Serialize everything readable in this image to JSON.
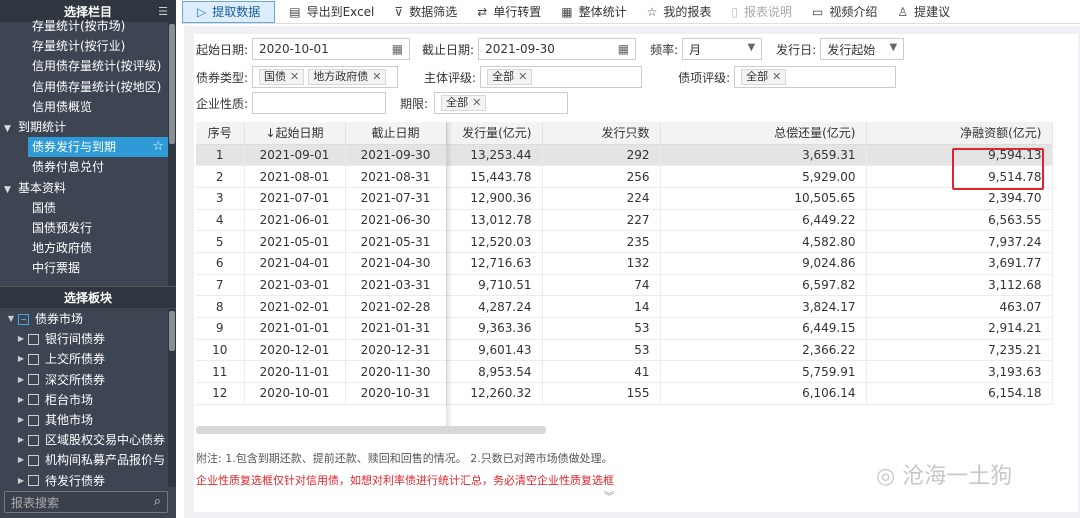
{
  "sidebar": {
    "title": "选择栏目",
    "items": [
      {
        "label": "存量统计(按市场)",
        "type": "sub"
      },
      {
        "label": "存量统计(按行业)",
        "type": "sub"
      },
      {
        "label": "信用债存量统计(按评级)",
        "type": "sub"
      },
      {
        "label": "信用债存量统计(按地区)",
        "type": "sub"
      },
      {
        "label": "信用债概览",
        "type": "sub"
      },
      {
        "label": "到期统计",
        "type": "cat"
      },
      {
        "label": "债券发行与到期",
        "type": "active"
      },
      {
        "label": "债券付息兑付",
        "type": "sub"
      },
      {
        "label": "基本资料",
        "type": "cat"
      },
      {
        "label": "国债",
        "type": "sub"
      },
      {
        "label": "国债预发行",
        "type": "sub"
      },
      {
        "label": "地方政府债",
        "type": "sub"
      },
      {
        "label": "中行票据",
        "type": "sub"
      }
    ],
    "section2_title": "选择板块",
    "tree": [
      {
        "label": "债券市场",
        "level": 0,
        "state": "partial",
        "arrow": "▼"
      },
      {
        "label": "银行间债券",
        "level": 1,
        "state": "empty",
        "arrow": "▶"
      },
      {
        "label": "上交所债券",
        "level": 1,
        "state": "empty",
        "arrow": "▶"
      },
      {
        "label": "深交所债券",
        "level": 1,
        "state": "empty",
        "arrow": "▶"
      },
      {
        "label": "柜台市场",
        "level": 1,
        "state": "empty",
        "arrow": "▶"
      },
      {
        "label": "其他市场",
        "level": 1,
        "state": "empty",
        "arrow": "▶"
      },
      {
        "label": "区域股权交易中心债券",
        "level": 1,
        "state": "empty",
        "arrow": "▶"
      },
      {
        "label": "机构间私募产品报价与",
        "level": 1,
        "state": "empty",
        "arrow": "▶"
      },
      {
        "label": "待发行债券",
        "level": 1,
        "state": "empty",
        "arrow": "▶"
      }
    ],
    "search_placeholder": "报表搜索"
  },
  "toolbar": {
    "items": [
      {
        "label": "提取数据",
        "icon": "play-icon",
        "glyph": "▷",
        "style": "primary"
      },
      {
        "label": "导出到Excel",
        "icon": "excel-icon",
        "glyph": "▤",
        "style": ""
      },
      {
        "label": "数据筛选",
        "icon": "filter-icon",
        "glyph": "⊽",
        "style": ""
      },
      {
        "label": "单行转置",
        "icon": "transpose-icon",
        "glyph": "⇄",
        "style": ""
      },
      {
        "label": "整体统计",
        "icon": "stats-icon",
        "glyph": "▦",
        "style": ""
      },
      {
        "label": "我的报表",
        "icon": "star-icon",
        "glyph": "☆",
        "style": ""
      },
      {
        "label": "报表说明",
        "icon": "doc-icon",
        "glyph": "▯",
        "style": "disabled"
      },
      {
        "label": "视频介绍",
        "icon": "video-icon",
        "glyph": "▭",
        "style": ""
      },
      {
        "label": "提建议",
        "icon": "user-icon",
        "glyph": "♙",
        "style": ""
      }
    ]
  },
  "filters": {
    "start_label": "起始日期:",
    "start_value": "2020-10-01",
    "end_label": "截止日期:",
    "end_value": "2021-09-30",
    "freq_label": "频率:",
    "freq_value": "月",
    "issue_label": "发行日:",
    "issue_value": "发行起始",
    "bondtype_label": "债券类型:",
    "bondtype_tags": [
      "国债",
      "地方政府债"
    ],
    "rating_label": "主体评级:",
    "rating_tags": [
      "全部"
    ],
    "itemrating_label": "债项评级:",
    "itemrating_tags": [
      "全部"
    ],
    "nature_label": "企业性质:",
    "term_label": "期限:",
    "term_tags": [
      "全部"
    ]
  },
  "table": {
    "headers": [
      "序号",
      "↓起始日期",
      "截止日期",
      "发行量(亿元)",
      "发行只数",
      "总偿还量(亿元)",
      "净融资额(亿元)"
    ],
    "rows": [
      [
        "1",
        "2021-09-01",
        "2021-09-30",
        "13,253.44",
        "292",
        "3,659.31",
        "9,594.13"
      ],
      [
        "2",
        "2021-08-01",
        "2021-08-31",
        "15,443.78",
        "256",
        "5,929.00",
        "9,514.78"
      ],
      [
        "3",
        "2021-07-01",
        "2021-07-31",
        "12,900.36",
        "224",
        "10,505.65",
        "2,394.70"
      ],
      [
        "4",
        "2021-06-01",
        "2021-06-30",
        "13,012.78",
        "227",
        "6,449.22",
        "6,563.55"
      ],
      [
        "5",
        "2021-05-01",
        "2021-05-31",
        "12,520.03",
        "235",
        "4,582.80",
        "7,937.24"
      ],
      [
        "6",
        "2021-04-01",
        "2021-04-30",
        "12,716.63",
        "132",
        "9,024.86",
        "3,691.77"
      ],
      [
        "7",
        "2021-03-01",
        "2021-03-31",
        "9,710.51",
        "74",
        "6,597.82",
        "3,112.68"
      ],
      [
        "8",
        "2021-02-01",
        "2021-02-28",
        "4,287.24",
        "14",
        "3,824.17",
        "463.07"
      ],
      [
        "9",
        "2021-01-01",
        "2021-01-31",
        "9,363.36",
        "53",
        "6,449.15",
        "2,914.21"
      ],
      [
        "10",
        "2020-12-01",
        "2020-12-31",
        "9,601.43",
        "53",
        "2,366.22",
        "7,235.21"
      ],
      [
        "11",
        "2020-11-01",
        "2020-11-30",
        "8,953.54",
        "41",
        "5,759.91",
        "3,193.63"
      ],
      [
        "12",
        "2020-10-01",
        "2020-10-31",
        "12,260.32",
        "155",
        "6,106.14",
        "6,154.18"
      ]
    ],
    "selected_row": 0
  },
  "notes": {
    "note1": "附注: 1.包含到期还款、提前还款、赎回和回售的情况。 2.只数已对跨市场债做处理。",
    "note2": "企业性质复选框仅针对信用债，如想对利率债进行统计汇总，务必清空企业性质复选框"
  },
  "watermark": "沧海一土狗",
  "colors": {
    "accent": "#2e9bd6",
    "highlight": "#e0242b",
    "sidebar": "#3d4552"
  }
}
